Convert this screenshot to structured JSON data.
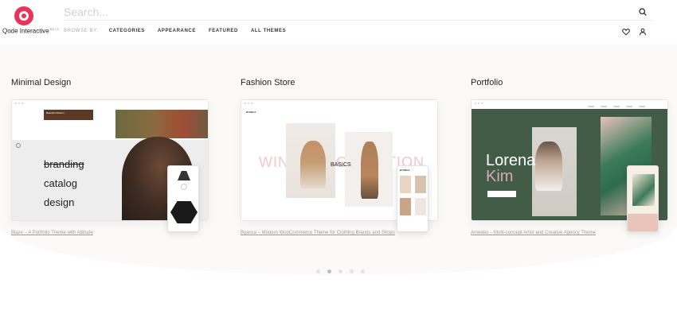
{
  "brand": {
    "name": "Qode Interactive",
    "badge": "BETA"
  },
  "search": {
    "placeholder": "Search..."
  },
  "nav": {
    "browse_label": "BROWSE BY:",
    "items": [
      "CATEGORIES",
      "APPEARANCE",
      "FEATURED",
      "ALL THEMES"
    ]
  },
  "header_icons": [
    "search-icon",
    "heart-icon",
    "user-icon"
  ],
  "cards": [
    {
      "title": "Minimal Design",
      "caption": "Blaze – A Portfolio Theme with Attitude",
      "preview": {
        "heading": "Beautiful Modern",
        "words": [
          "branding",
          "catalog",
          "design"
        ]
      }
    },
    {
      "title": "Fashion Store",
      "caption": "Byanca – Modern WooCommerce Theme for Clothing Brands and Shops",
      "preview": {
        "logo": "BYANCA",
        "overlay": "WINTER COLLECTION",
        "label": "BASICS"
      }
    },
    {
      "title": "Portfolio",
      "caption": "Amedeo – Multi-concept Artist and Creative Agency Theme",
      "preview": {
        "first": "Lorena",
        "last": "Kim"
      }
    }
  ],
  "pagination": {
    "total": 5,
    "active": 1
  },
  "colors": {
    "brand": "#e8345a",
    "portfolio_bg": "#435c47",
    "accent_pink": "#d5a9b5"
  }
}
